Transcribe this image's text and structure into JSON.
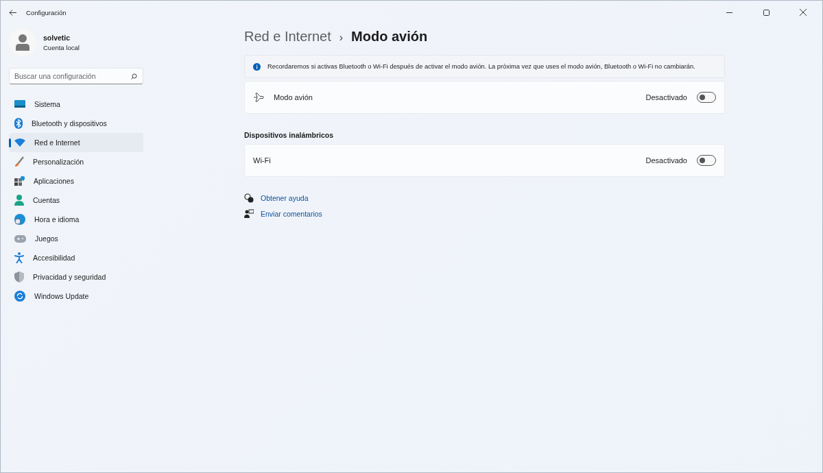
{
  "window": {
    "title": "Configuración"
  },
  "user": {
    "name": "solvetic",
    "account": "Cuenta local"
  },
  "search": {
    "placeholder": "Buscar una configuración"
  },
  "nav": [
    {
      "label": "Sistema",
      "selected": false
    },
    {
      "label": "Bluetooth y dispositivos",
      "selected": false
    },
    {
      "label": "Red e Internet",
      "selected": true
    },
    {
      "label": "Personalización",
      "selected": false
    },
    {
      "label": "Aplicaciones",
      "selected": false
    },
    {
      "label": "Cuentas",
      "selected": false
    },
    {
      "label": "Hora e idioma",
      "selected": false
    },
    {
      "label": "Juegos",
      "selected": false
    },
    {
      "label": "Accesibilidad",
      "selected": false
    },
    {
      "label": "Privacidad y seguridad",
      "selected": false
    },
    {
      "label": "Windows Update",
      "selected": false
    }
  ],
  "breadcrumb": {
    "parent": "Red e Internet",
    "separator": "›",
    "current": "Modo avión"
  },
  "info": "Recordaremos si activas Bluetooth o Wi-Fi después de activar el modo avión. La próxima vez que uses el modo avión, Bluetooth o Wi-Fi no cambiarán.",
  "airplane": {
    "label": "Modo avión",
    "status": "Desactivado",
    "on": false
  },
  "section": {
    "title": "Dispositivos inalámbricos",
    "rows": [
      {
        "label": "Wi-Fi",
        "status": "Desactivado",
        "on": false
      }
    ]
  },
  "links": [
    {
      "label": "Obtener ayuda"
    },
    {
      "label": "Enviar comentarios"
    }
  ]
}
